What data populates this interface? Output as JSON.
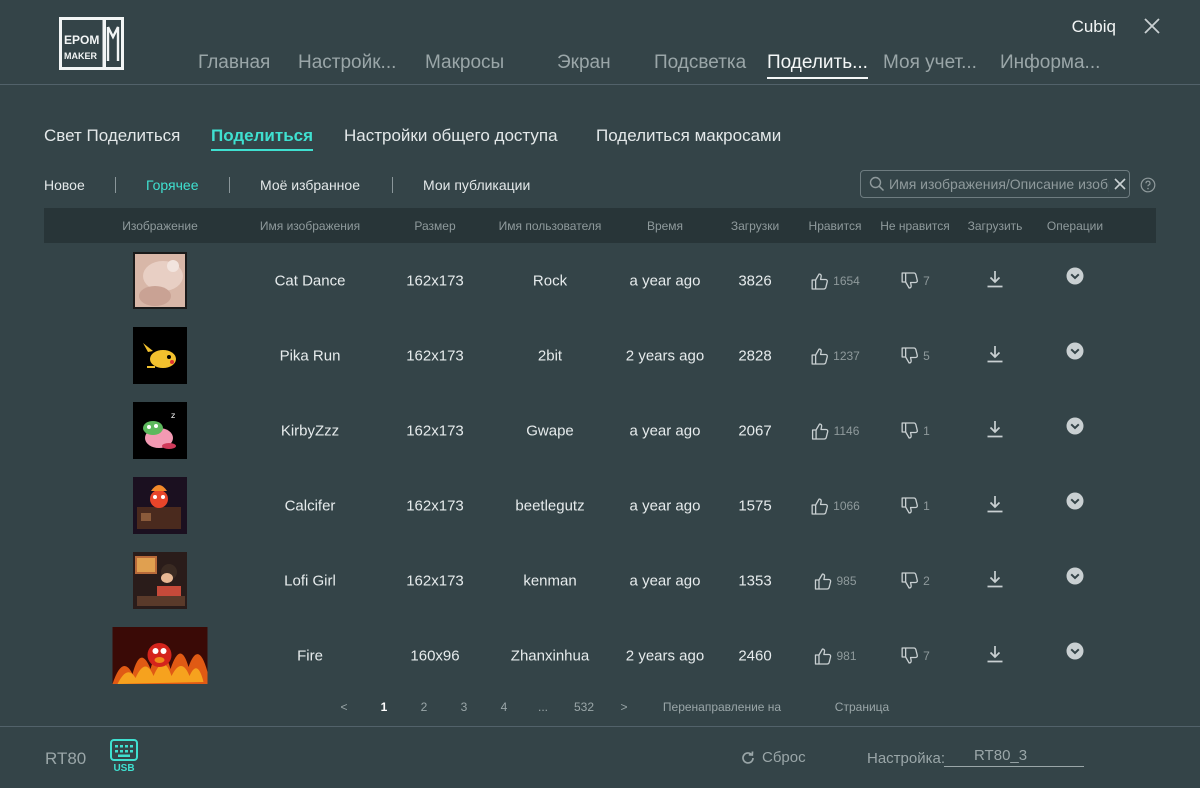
{
  "header": {
    "logo_text_top": "EPOM",
    "logo_text_bottom": "MAKER",
    "user": "Cubiq",
    "nav": [
      {
        "label": "Главная"
      },
      {
        "label": "Настройк..."
      },
      {
        "label": "Макросы"
      },
      {
        "label": "Экран"
      },
      {
        "label": "Подсветка"
      },
      {
        "label": "Поделить..."
      },
      {
        "label": "Моя учет..."
      },
      {
        "label": "Информа..."
      }
    ],
    "active_nav": 5
  },
  "sub_tabs": [
    {
      "label": "Свет Поделиться"
    },
    {
      "label": "Поделиться"
    },
    {
      "label": "Настройки общего доступа"
    },
    {
      "label": "Поделиться макросами"
    }
  ],
  "filters": [
    {
      "label": "Новое"
    },
    {
      "label": "Горячее"
    },
    {
      "label": "Моё избранное"
    },
    {
      "label": "Мои публикации"
    }
  ],
  "search": {
    "placeholder": "Имя изображения/Описание изображения"
  },
  "table": {
    "columns": [
      "Изображение",
      "Имя изображения",
      "Размер",
      "Имя пользователя",
      "Время",
      "Загрузки",
      "Нравится",
      "Не нравится",
      "Загрузить",
      "Операции"
    ],
    "rows": [
      {
        "name": "Cat Dance",
        "size": "162x173",
        "user": "Rock",
        "time": "a year ago",
        "downloads": "3826",
        "likes": "1654",
        "dislikes": "7"
      },
      {
        "name": "Pika Run",
        "size": "162x173",
        "user": "2bit",
        "time": "2 years ago",
        "downloads": "2828",
        "likes": "1237",
        "dislikes": "5"
      },
      {
        "name": "KirbyZzz",
        "size": "162x173",
        "user": "Gwape",
        "time": "a year ago",
        "downloads": "2067",
        "likes": "1146",
        "dislikes": "1"
      },
      {
        "name": "Calcifer",
        "size": "162x173",
        "user": "beetlegutz",
        "time": "a year ago",
        "downloads": "1575",
        "likes": "1066",
        "dislikes": "1"
      },
      {
        "name": "Lofi Girl",
        "size": "162x173",
        "user": "kenman",
        "time": "a year ago",
        "downloads": "1353",
        "likes": "985",
        "dislikes": "2"
      },
      {
        "name": "Fire",
        "size": "160x96",
        "user": "Zhanxinhua",
        "time": "2 years ago",
        "downloads": "2460",
        "likes": "981",
        "dislikes": "7"
      }
    ]
  },
  "pagination": {
    "prev": "<",
    "pages": [
      "1",
      "2",
      "3",
      "4",
      "...",
      "532"
    ],
    "current": "1",
    "next": ">",
    "goto_label": "Перенаправление на",
    "page_label": "Страница"
  },
  "footer": {
    "device": "RT80",
    "usb_label": "USB",
    "reset_label": "Сброс",
    "profile_label": "Настройка:",
    "profile_value": "RT80_3"
  },
  "colors": {
    "accent": "#3fe0d0",
    "background": "#344448",
    "header_row": "#283538"
  }
}
